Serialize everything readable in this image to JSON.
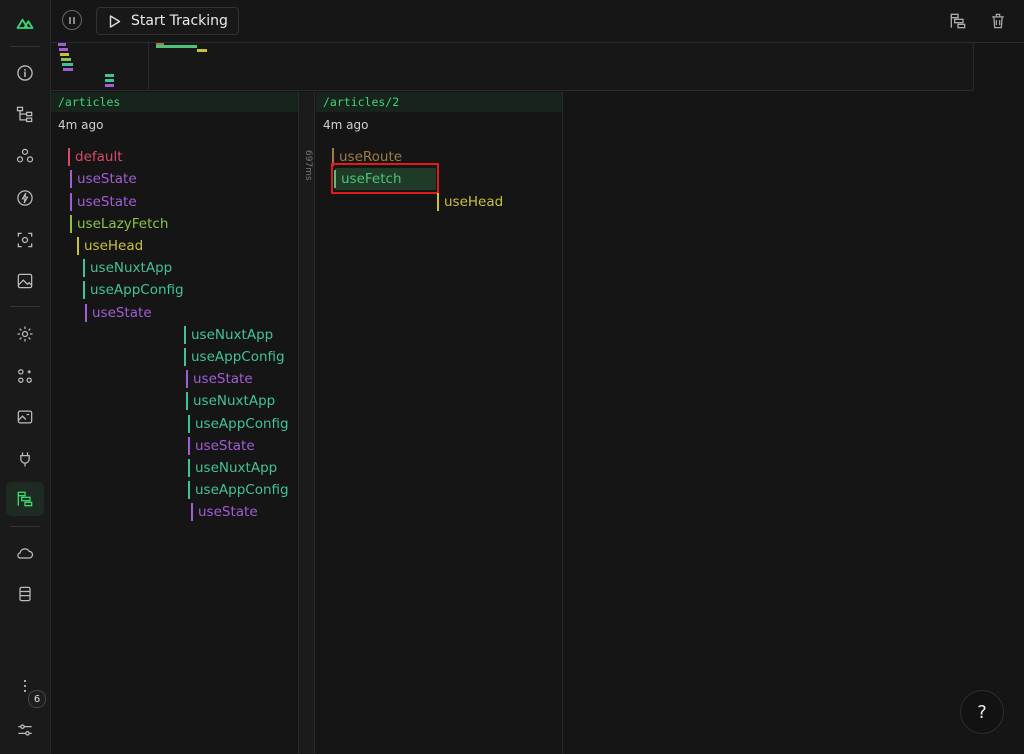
{
  "toolbar": {
    "start_label": "Start Tracking"
  },
  "columns": [
    {
      "route": "/articles",
      "time": "4m ago"
    },
    {
      "route": "/articles/2",
      "time": "4m ago"
    }
  ],
  "gap_label": "697ms",
  "left_tree": [
    {
      "label": "default",
      "color": "#d94a6a"
    },
    {
      "label": "useState",
      "color": "#a35dd6"
    },
    {
      "label": "useState",
      "color": "#a35dd6"
    },
    {
      "label": "useLazyFetch",
      "color": "#8ac34a"
    },
    {
      "label": "useHead",
      "color": "#c7c13f"
    },
    {
      "label": "useNuxtApp",
      "color": "#42c29a"
    },
    {
      "label": "useAppConfig",
      "color": "#42c29a"
    },
    {
      "label": "useState",
      "color": "#a35dd6"
    },
    {
      "label": "useNuxtApp",
      "color": "#42c29a"
    },
    {
      "label": "useAppConfig",
      "color": "#42c29a"
    },
    {
      "label": "useState",
      "color": "#a35dd6"
    },
    {
      "label": "useNuxtApp",
      "color": "#42c29a"
    },
    {
      "label": "useAppConfig",
      "color": "#42c29a"
    },
    {
      "label": "useState",
      "color": "#a35dd6"
    },
    {
      "label": "useNuxtApp",
      "color": "#42c29a"
    },
    {
      "label": "useAppConfig",
      "color": "#42c29a"
    },
    {
      "label": "useState",
      "color": "#a35dd6"
    }
  ],
  "right_tree": [
    {
      "label": "useRoute",
      "color": "#a07b46"
    },
    {
      "label": "useFetch",
      "color": "#4fc27b"
    },
    {
      "label": "useHead",
      "color": "#c7c13f"
    }
  ],
  "sidebar": {
    "badge": "6"
  },
  "help_label": "?"
}
